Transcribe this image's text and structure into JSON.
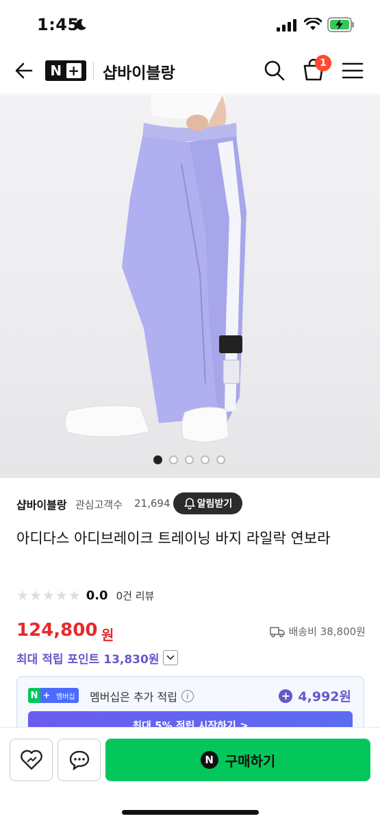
{
  "status_bar": {
    "time": "1:45"
  },
  "header": {
    "logo_n": "N",
    "logo_plus": "+",
    "store_name": "샵바이블랑",
    "cart_count": "1"
  },
  "carousel": {
    "total": 5,
    "active": 1
  },
  "seller": {
    "name": "샵바이블랑",
    "followers_label": "관심고객수",
    "followers_count": "21,694",
    "alarm_label": "알림받기"
  },
  "product": {
    "title": "아디다스 아디브레이크 트레이닝 바지 라일락 연보라",
    "rating": "0.0",
    "review_count": "0건 리뷰",
    "price": "124,800",
    "price_unit": "원",
    "shipping": "배송비 38,800원",
    "max_points": "최대 적립 포인트 13,830원"
  },
  "membership": {
    "badge_n": "N",
    "badge_plus": "+",
    "badge_text": "멤버십",
    "label": "멤버십은 추가 적립",
    "info": "i",
    "points": "4,992원",
    "cta": "최대 5% 적립 시작하기 >"
  },
  "bottom_bar": {
    "buy_n": "N",
    "buy_label": "구매하기"
  },
  "colors": {
    "price_red": "#e8272c",
    "points_purple": "#6a56c8",
    "buy_green": "#03c75a",
    "badge_red": "#ff4a2f"
  }
}
